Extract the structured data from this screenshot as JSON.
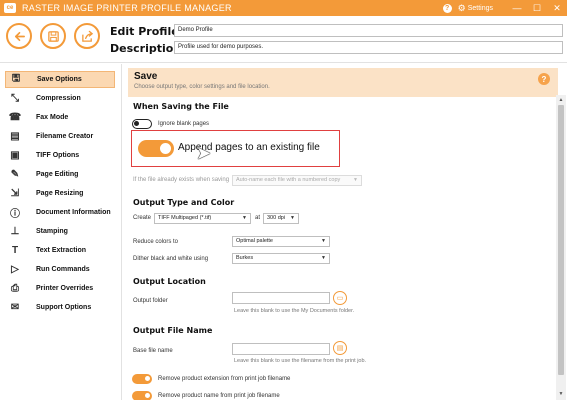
{
  "titlebar": {
    "logo": "ce",
    "title": "RASTER IMAGE PRINTER PROFILE MANAGER",
    "help_icon": "?",
    "settings_label": "Settings",
    "minimize": "—",
    "maximize": "☐",
    "close": "✕"
  },
  "header": {
    "back_icon": "back-arrow-icon",
    "save_icon": "save-icon",
    "export_icon": "export-icon",
    "edit_profile_label": "Edit Profile -",
    "description_label": "Description",
    "profile_name_value": "Demo Profile",
    "description_value": "Profile used for demo purposes."
  },
  "sidebar": {
    "items": [
      {
        "label": "Save Options",
        "icon": "save-icon",
        "active": true
      },
      {
        "label": "Compression",
        "icon": "compress-icon",
        "active": false
      },
      {
        "label": "Fax Mode",
        "icon": "fax-icon",
        "active": false
      },
      {
        "label": "Filename Creator",
        "icon": "file-icon",
        "active": false
      },
      {
        "label": "TIFF Options",
        "icon": "tiff-icon",
        "active": false
      },
      {
        "label": "Page Editing",
        "icon": "page-edit-icon",
        "active": false
      },
      {
        "label": "Page Resizing",
        "icon": "resize-icon",
        "active": false
      },
      {
        "label": "Document Information",
        "icon": "info-icon",
        "active": false
      },
      {
        "label": "Stamping",
        "icon": "stamp-icon",
        "active": false
      },
      {
        "label": "Text Extraction",
        "icon": "text-icon",
        "active": false
      },
      {
        "label": "Run Commands",
        "icon": "run-icon",
        "active": false
      },
      {
        "label": "Printer Overrides",
        "icon": "printer-icon",
        "active": false
      },
      {
        "label": "Support Options",
        "icon": "support-icon",
        "active": false
      }
    ]
  },
  "main": {
    "title": "Save",
    "subtitle": "Choose output type, color settings and file location.",
    "help": "?",
    "when_saving": {
      "title": "When Saving the File",
      "ignore_blank_label": "Ignore blank pages",
      "ignore_blank_on": false,
      "append_label": "Append pages to an existing file",
      "append_on": true,
      "exists_label": "If the file already exists when saving",
      "exists_value": "Auto-name each file with a numbered copy"
    },
    "output_type": {
      "title": "Output Type and Color",
      "create_label": "Create",
      "create_value": "TIFF Multipaged (*.tif)",
      "at_label": "at",
      "dpi_value": "300 dpi",
      "reduce_label": "Reduce colors to",
      "reduce_value": "Optimal palette",
      "dither_label": "Dither black and white using",
      "dither_value": "Burkes"
    },
    "output_location": {
      "title": "Output Location",
      "folder_label": "Output folder",
      "folder_value": "",
      "folder_hint": "Leave this blank to use the My Documents folder."
    },
    "output_file_name": {
      "title": "Output File Name",
      "base_label": "Base file name",
      "base_value": "",
      "base_hint": "Leave this blank to use the filename from the print job.",
      "remove_ext_label": "Remove product extension from print job filename",
      "remove_ext_on": true,
      "remove_name_label": "Remove product name from print job filename",
      "remove_name_on": true
    }
  },
  "colors": {
    "accent": "#f39a39",
    "active_nav": "#fbd8b2",
    "section_header": "#fbe2c6",
    "highlight_border": "#e04040"
  }
}
